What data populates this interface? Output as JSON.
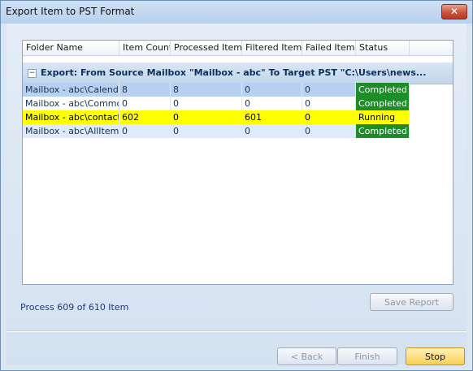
{
  "window": {
    "title": "Export Item to PST Format",
    "close_label": "✕"
  },
  "grid": {
    "columns": [
      "Folder Name",
      "Item Count",
      "Processed Items",
      "Filtered Items",
      "Failed Items",
      "Status"
    ],
    "group": {
      "toggle": "−",
      "text": "Export: From Source Mailbox \"Mailbox - abc\" To Target PST \"C:\\Users\\news..."
    },
    "rows": [
      {
        "folder": "Mailbox - abc\\Calendar",
        "item_count": "8",
        "processed": "8",
        "filtered": "0",
        "failed": "0",
        "status": "Completed"
      },
      {
        "folder": "Mailbox - abc\\Commo...",
        "item_count": "0",
        "processed": "0",
        "filtered": "0",
        "failed": "0",
        "status": "Completed"
      },
      {
        "folder": "Mailbox - abc\\contact",
        "item_count": "602",
        "processed": "0",
        "filtered": "601",
        "failed": "0",
        "status": "Running"
      },
      {
        "folder": "Mailbox - abc\\AllItems",
        "item_count": "0",
        "processed": "0",
        "filtered": "0",
        "failed": "0",
        "status": "Completed"
      }
    ]
  },
  "progress_text": "Process 609 of 610 Item",
  "buttons": {
    "save_report": "Save Report",
    "back": "< Back",
    "finish": "Finish",
    "stop": "Stop"
  },
  "colors": {
    "running_row": "#ffff00",
    "completed_status": "#1f8c2a"
  }
}
